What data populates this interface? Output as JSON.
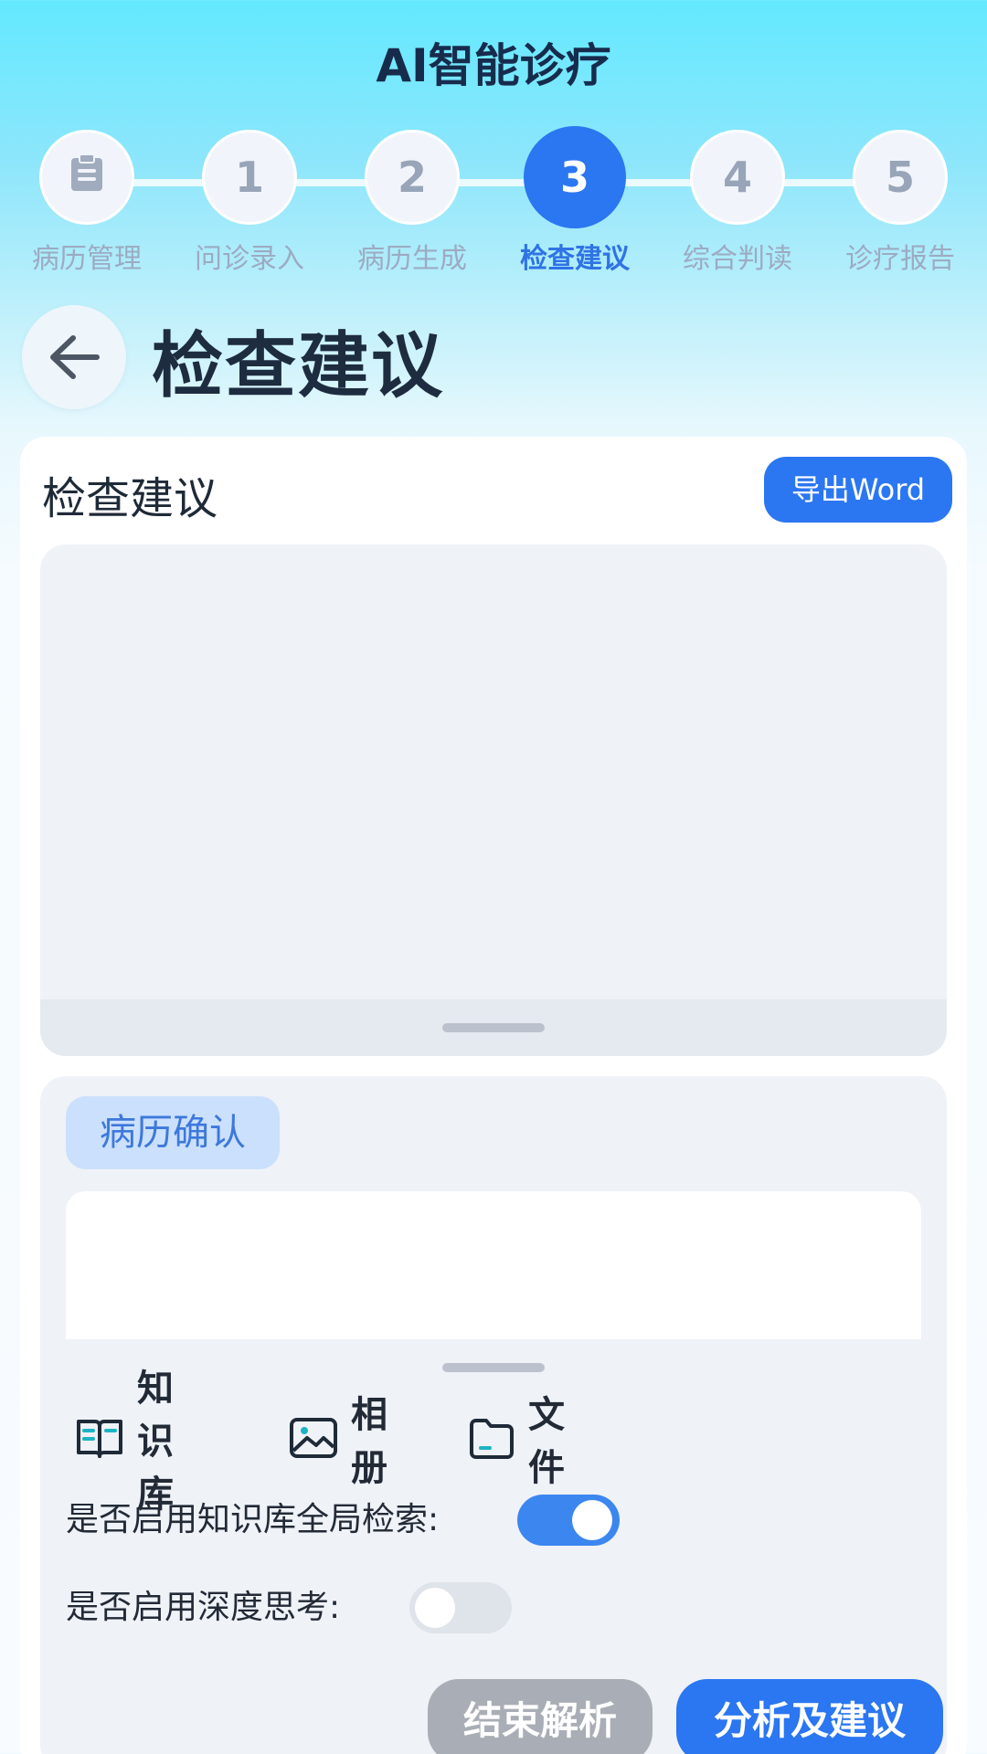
{
  "app": {
    "title": "AI智能诊疗"
  },
  "stepper": {
    "steps": [
      {
        "label": "病历管理",
        "icon": "clipboard-icon"
      },
      {
        "number": "1",
        "label": "问诊录入"
      },
      {
        "number": "2",
        "label": "病历生成"
      },
      {
        "number": "3",
        "label": "检查建议",
        "active": true
      },
      {
        "number": "4",
        "label": "综合判读"
      },
      {
        "number": "5",
        "label": "诊疗报告"
      }
    ],
    "active_color": "#2b76f1"
  },
  "header": {
    "back_icon": "arrow-left-icon",
    "title": "检查建议"
  },
  "card": {
    "title": "检查建议",
    "export_label": "导出Word"
  },
  "input_panel": {
    "tag": "病历确认",
    "input_value": "",
    "tools": [
      {
        "label": "知识库",
        "icon": "book-icon"
      },
      {
        "label": "相册",
        "icon": "image-icon"
      },
      {
        "label": "文件",
        "icon": "folder-icon"
      }
    ],
    "toggles": [
      {
        "label": "是否启用知识库全局检索:",
        "on": true
      },
      {
        "label": "是否启用深度思考:",
        "on": false
      }
    ],
    "end_label": "结束解析",
    "analyze_label": "分析及建议"
  },
  "colors": {
    "primary": "#2b76f1",
    "disabled": "#a9adb5",
    "title": "#172c4c"
  }
}
